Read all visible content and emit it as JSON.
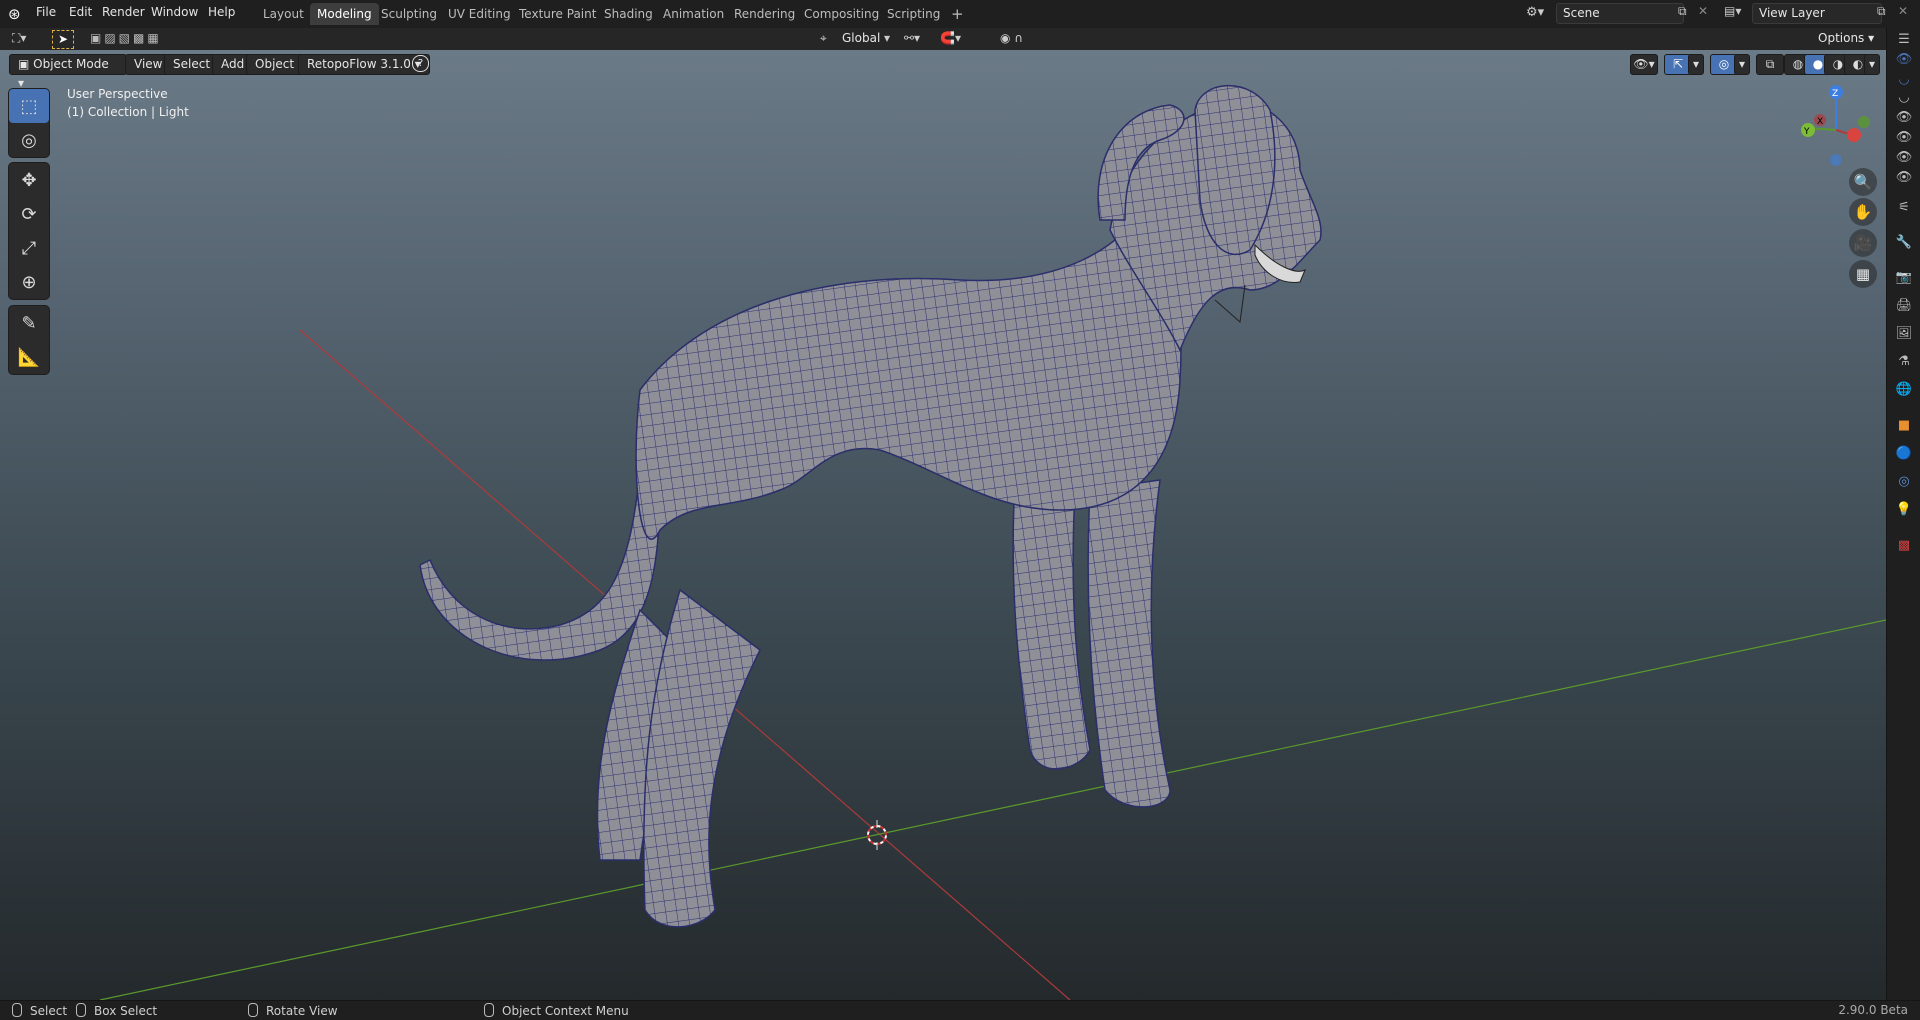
{
  "app": {
    "name": "Blender",
    "version": "2.90.0 Beta"
  },
  "menu": [
    "File",
    "Edit",
    "Render",
    "Window",
    "Help"
  ],
  "workspace_tabs": [
    {
      "label": "Layout",
      "active": false
    },
    {
      "label": "Modeling",
      "active": true
    },
    {
      "label": "Sculpting",
      "active": false
    },
    {
      "label": "UV Editing",
      "active": false
    },
    {
      "label": "Texture Paint",
      "active": false
    },
    {
      "label": "Shading",
      "active": false
    },
    {
      "label": "Animation",
      "active": false
    },
    {
      "label": "Rendering",
      "active": false
    },
    {
      "label": "Compositing",
      "active": false
    },
    {
      "label": "Scripting",
      "active": false
    }
  ],
  "add_workspace": "+",
  "scene": {
    "value": "Scene"
  },
  "view_layer": {
    "value": "View Layer"
  },
  "header2": {
    "transform_orientation": "Global",
    "options": "Options"
  },
  "viewport_header": {
    "mode": "Object Mode",
    "menus": [
      "View",
      "Select",
      "Add",
      "Object"
    ],
    "addon": "RetopoFlow 3.1.0",
    "help": "?"
  },
  "viewport_overlay": {
    "perspective": "User Perspective",
    "collection": "(1) Collection | Light"
  },
  "gizmo_axes": {
    "z": "Z",
    "y": "Y",
    "x": "X"
  },
  "statusbar": {
    "select": "Select",
    "box_select": "Box Select",
    "rotate_view": "Rotate View",
    "context_menu": "Object Context Menu",
    "version": "2.90.0 Beta"
  },
  "colors": {
    "accent": "#4772b3",
    "x_axis": "#b03a3a",
    "y_axis": "#5a9a2c",
    "z_axis": "#3d7fe0",
    "mesh_wire": "#2a2e6a",
    "mesh_fill": "#8e8e96"
  }
}
